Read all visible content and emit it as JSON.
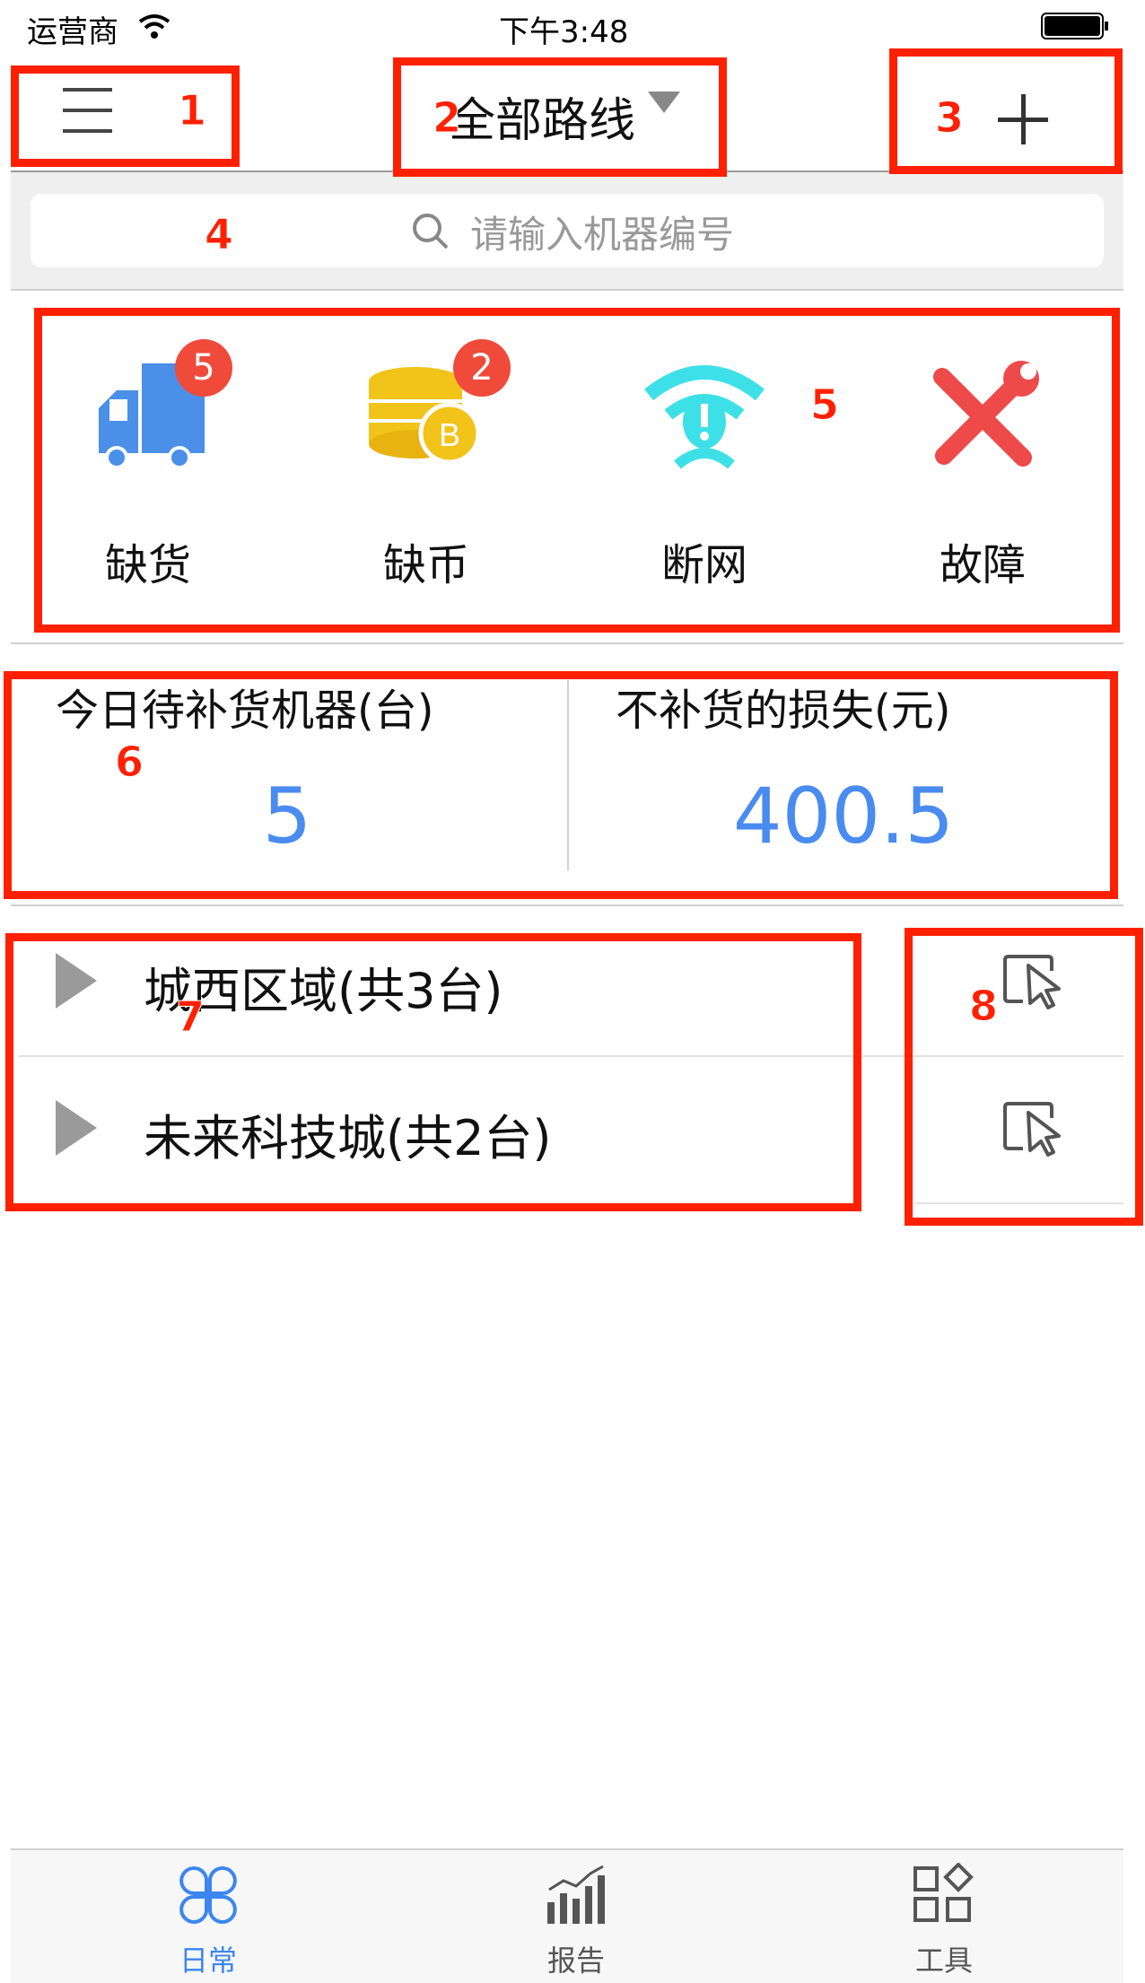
{
  "status_bar": {
    "carrier": "运营商",
    "time": "下午3:48"
  },
  "header": {
    "title": "全部路线"
  },
  "search": {
    "placeholder": "请输入机器编号"
  },
  "categories": [
    {
      "label": "缺货",
      "badge": "5",
      "icon": "truck-icon"
    },
    {
      "label": "缺币",
      "badge": "2",
      "icon": "coins-icon"
    },
    {
      "label": "断网",
      "icon": "wifi-alert-icon"
    },
    {
      "label": "故障",
      "icon": "tools-icon"
    }
  ],
  "stats": {
    "pending": {
      "title": "今日待补货机器(台)",
      "value": "5"
    },
    "loss": {
      "title": "不补货的损失(元)",
      "value": "400.5"
    }
  },
  "routes": [
    {
      "label": "城西区域(共3台)"
    },
    {
      "label": "未来科技城(共2台)"
    }
  ],
  "tabs": [
    {
      "label": "日常",
      "active": true
    },
    {
      "label": "报告"
    },
    {
      "label": "工具"
    }
  ],
  "annotations": [
    "1",
    "2",
    "3",
    "4",
    "5",
    "5",
    "6",
    "7",
    "8"
  ],
  "colors": {
    "accent": "#4a8bf0",
    "annotation": "#ff2000",
    "badge": "#f04a3a"
  }
}
